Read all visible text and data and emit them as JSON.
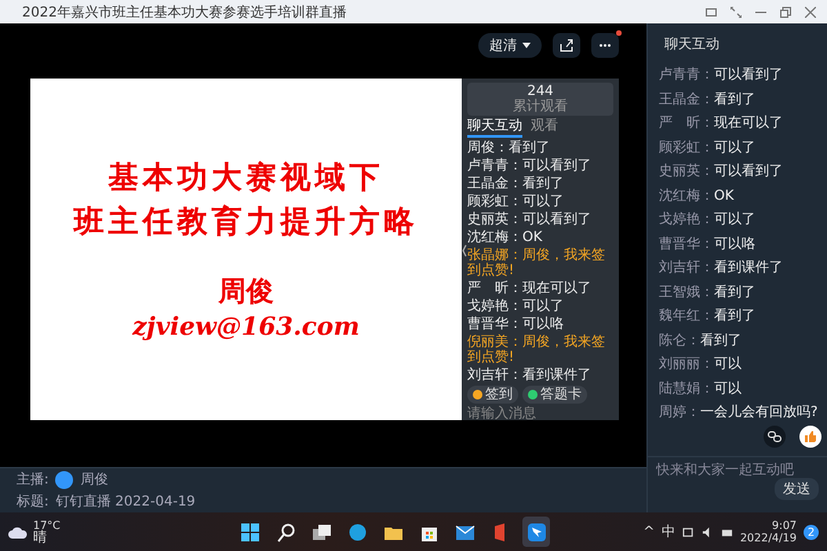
{
  "window": {
    "title": "2022年嘉兴市班主任基本功大赛参赛选手培训群直播"
  },
  "player": {
    "quality": "超清",
    "notification": true,
    "slide": {
      "lines": [
        "基本功大赛视域下",
        "班主任教育力提升方略"
      ],
      "author": "周俊",
      "email": "zjview@163.com"
    },
    "inner_panel": {
      "count": "244",
      "count_label": "累计观看",
      "tabs": [
        {
          "label": "聊天互动",
          "selected": true
        },
        {
          "label": "观看",
          "selected": false
        }
      ],
      "messages": [
        {
          "name": "周俊：",
          "text": "看到了",
          "kind": "normal"
        },
        {
          "name": "卢青青：",
          "text": "可以看到了",
          "kind": "normal"
        },
        {
          "name": "王晶金：",
          "text": "看到了",
          "kind": "normal"
        },
        {
          "name": "顾彩虹：",
          "text": "可以了",
          "kind": "normal"
        },
        {
          "name": "史丽英：",
          "text": "可以看到了",
          "kind": "normal"
        },
        {
          "name": "沈红梅：",
          "text": "OK",
          "kind": "normal"
        },
        {
          "name": "张晶娜：",
          "text": "周俊，我来签到点赞!",
          "kind": "highlight"
        },
        {
          "name": "严　昕：",
          "text": "现在可以了",
          "kind": "normal"
        },
        {
          "name": "戈婷艳：",
          "text": "可以了",
          "kind": "normal"
        },
        {
          "name": "曹晋华：",
          "text": "可以咯",
          "kind": "normal"
        },
        {
          "name": "倪丽美：",
          "text": "周俊，我来签到点赞!",
          "kind": "highlight"
        },
        {
          "name": "刘吉轩：",
          "text": "看到课件了",
          "kind": "normal"
        }
      ],
      "actions": [
        {
          "label": "签到",
          "color": "#f5a623"
        },
        {
          "label": "答题卡",
          "color": "#2ecc71"
        }
      ],
      "placeholder": "请输入消息"
    }
  },
  "host": {
    "label": "主播:",
    "name": "周俊"
  },
  "topic": {
    "label": "标题:",
    "value": "钉钉直播 2022-04-19"
  },
  "chat": {
    "title": "聊天互动",
    "messages": [
      {
        "name": "卢青青：",
        "text": "可以看到了"
      },
      {
        "name": "王晶金：",
        "text": "看到了"
      },
      {
        "name": "严　昕：",
        "text": "现在可以了"
      },
      {
        "name": "顾彩虹：",
        "text": "可以了"
      },
      {
        "name": "史丽英：",
        "text": "可以看到了"
      },
      {
        "name": "沈红梅：",
        "text": "OK"
      },
      {
        "name": "戈婷艳：",
        "text": "可以了"
      },
      {
        "name": "曹晋华：",
        "text": "可以咯"
      },
      {
        "name": "刘吉轩：",
        "text": "看到课件了"
      },
      {
        "name": "王智娥：",
        "text": "看到了"
      },
      {
        "name": "魏年红：",
        "text": "看到了"
      },
      {
        "name": "陈仑：",
        "text": "看到了"
      },
      {
        "name": "刘丽丽：",
        "text": "可以"
      },
      {
        "name": "陆慧娟：",
        "text": "可以"
      },
      {
        "name": "周婷：",
        "text": "一会儿会有回放吗?"
      }
    ],
    "placeholder": "快来和大家一起互动吧",
    "send": "发送"
  },
  "taskbar": {
    "temperature": "17°C",
    "condition": "晴",
    "tray": [
      "^",
      "中"
    ],
    "time": "9:07",
    "date": "2022/4/19",
    "badge": "2"
  }
}
